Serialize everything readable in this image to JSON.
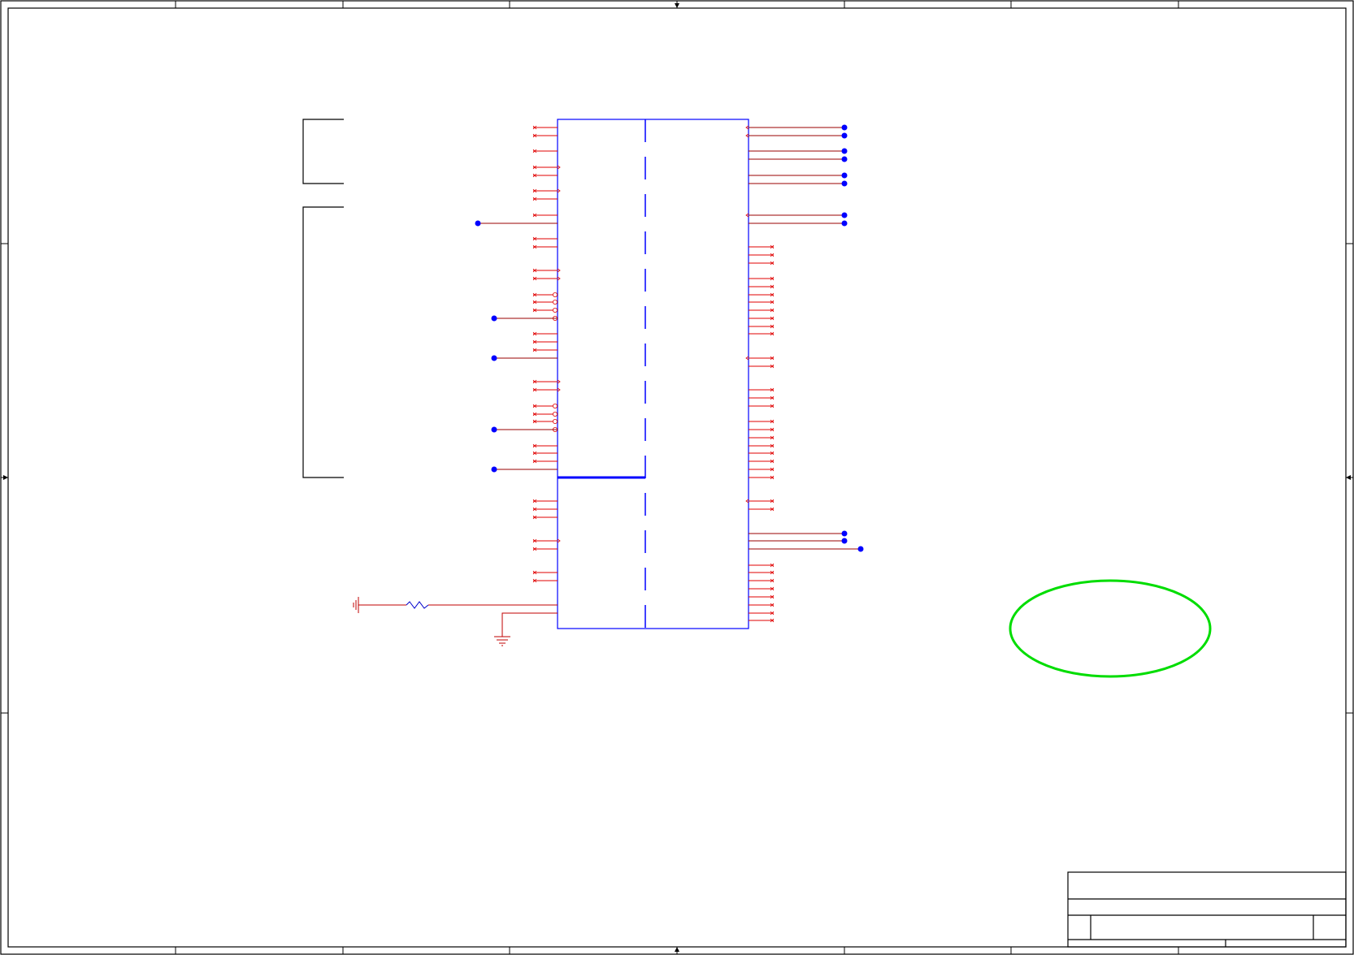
{
  "sheet": {
    "colors": {
      "frame": "#000000",
      "component": "#0000ff",
      "wire": "#c00000",
      "net_dot": "#0000ff",
      "highlight": "#00dd00",
      "background": "#ffffff"
    },
    "frame_divisions": {
      "columns": 8,
      "rows": 4
    },
    "components": [
      {
        "kind": "multi-part-ic",
        "icon": "ic-body"
      },
      {
        "kind": "resistor",
        "icon": "resistor-icon"
      },
      {
        "kind": "ground",
        "icon": "ground-icon"
      },
      {
        "kind": "chassis-ground",
        "icon": "chassis-ground-icon"
      }
    ],
    "annotations": [
      {
        "kind": "bracket-group",
        "icon": "bracket-icon"
      },
      {
        "kind": "bracket-group",
        "icon": "bracket-icon"
      },
      {
        "kind": "highlight-ellipse",
        "icon": "ellipse-icon"
      }
    ],
    "title_block": {
      "fields": []
    }
  }
}
